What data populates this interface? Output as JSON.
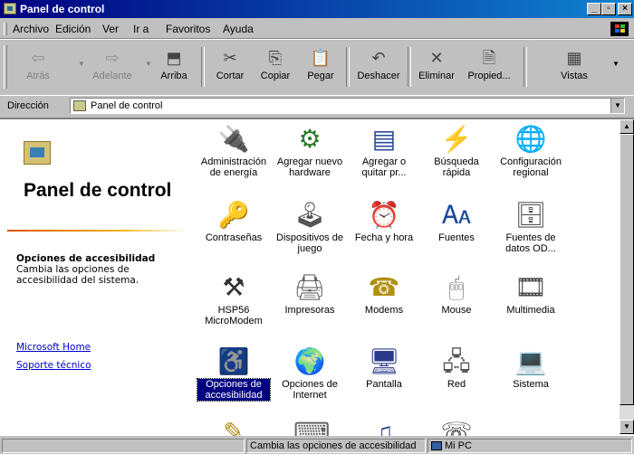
{
  "window": {
    "title": "Panel de control"
  },
  "menubar": {
    "items": [
      "Archivo",
      "Edición",
      "Ver",
      "Ir a",
      "Favoritos",
      "Ayuda"
    ]
  },
  "toolbar": {
    "back": "Atrás",
    "forward": "Adelante",
    "up": "Arriba",
    "cut": "Cortar",
    "copy": "Copiar",
    "paste": "Pegar",
    "undo": "Deshacer",
    "delete": "Eliminar",
    "properties": "Propied...",
    "views": "Vistas"
  },
  "address": {
    "label": "Dirección",
    "value": "Panel de control"
  },
  "left_pane": {
    "title": "Panel de control",
    "selected_title": "Opciones de accesibilidad",
    "selected_desc": "Cambia las opciones de accesibilidad del sistema.",
    "links": [
      "Microsoft Home",
      "Soporte técnico"
    ]
  },
  "items": [
    {
      "label": "Administración de energía",
      "icon": "power-management-icon"
    },
    {
      "label": "Agregar nuevo hardware",
      "icon": "add-hardware-icon"
    },
    {
      "label": "Agregar o quitar pr...",
      "icon": "add-remove-programs-icon"
    },
    {
      "label": "Búsqueda rápida",
      "icon": "find-fast-icon"
    },
    {
      "label": "Configuración regional",
      "icon": "regional-settings-icon"
    },
    {
      "label": "Contraseñas",
      "icon": "passwords-icon"
    },
    {
      "label": "Dispositivos de juego",
      "icon": "game-controllers-icon"
    },
    {
      "label": "Fecha y hora",
      "icon": "date-time-icon"
    },
    {
      "label": "Fuentes",
      "icon": "fonts-icon"
    },
    {
      "label": "Fuentes de datos OD...",
      "icon": "odbc-icon"
    },
    {
      "label": "HSP56 MicroModem",
      "icon": "modem-tools-icon"
    },
    {
      "label": "Impresoras",
      "icon": "printers-icon"
    },
    {
      "label": "Modems",
      "icon": "modems-icon"
    },
    {
      "label": "Mouse",
      "icon": "mouse-icon"
    },
    {
      "label": "Multimedia",
      "icon": "multimedia-icon"
    },
    {
      "label": "Opciones de accesibilidad",
      "icon": "accessibility-icon"
    },
    {
      "label": "Opciones de Internet",
      "icon": "internet-options-icon"
    },
    {
      "label": "Pantalla",
      "icon": "display-icon"
    },
    {
      "label": "Red",
      "icon": "network-icon"
    },
    {
      "label": "Sistema",
      "icon": "system-icon"
    }
  ],
  "status": {
    "message": "Cambia las opciones de accesibilidad",
    "zone": "Mi PC"
  }
}
